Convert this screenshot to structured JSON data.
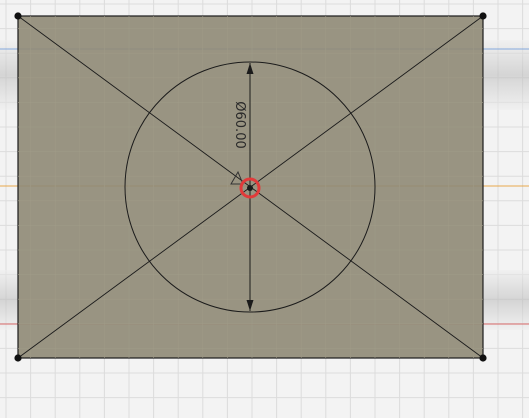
{
  "dimension": {
    "label": "Ø60.00",
    "value": 60.0
  },
  "colors": {
    "background": "#f3f3f3",
    "gridMinor": "#dcdcdc",
    "gridMajor": "#cbcbcb",
    "profileFill": "#8f8a76",
    "profileFillOpacity": 0.9,
    "sketchLine": "#1b1b1b",
    "xAxis": "#e8a23a",
    "yAxis": "#5b8fd9",
    "redLine": "#d64b4b",
    "snapRing": "#e13a3a",
    "sideShade": "#b9b9b9"
  },
  "icons": {
    "origin": "origin-point-icon",
    "constraint": "constraint-triangle-icon",
    "vertex": "vertex-point-icon"
  }
}
